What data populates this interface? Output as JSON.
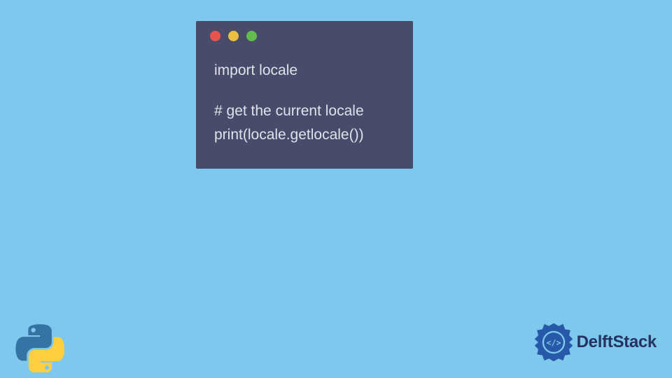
{
  "code": {
    "line1": "import locale",
    "line2": "# get the current locale",
    "line3": "print(locale.getlocale())"
  },
  "brand": {
    "name": "DelftStack"
  },
  "colors": {
    "bg": "#7ec8ed",
    "window": "#484c6a",
    "red": "#e7534e",
    "yellow": "#e8bf3f",
    "green": "#62bd4e"
  }
}
